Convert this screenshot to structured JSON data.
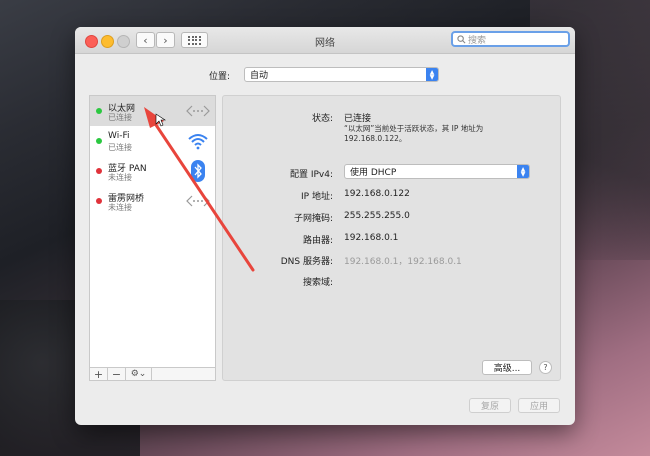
{
  "window": {
    "title": "网络"
  },
  "search": {
    "placeholder": "搜索"
  },
  "location": {
    "label": "位置:",
    "value": "自动"
  },
  "sidebar": {
    "items": [
      {
        "name": "以太网",
        "status": "已连接",
        "status_color": "#2bc840",
        "icon": "ethernet-icon"
      },
      {
        "name": "Wi-Fi",
        "status": "已连接",
        "status_color": "#2bc840",
        "icon": "wifi-icon"
      },
      {
        "name": "蓝牙 PAN",
        "status": "未连接",
        "status_color": "#e0323a",
        "icon": "bluetooth-icon"
      },
      {
        "name": "雷雳网桥",
        "status": "未连接",
        "status_color": "#e0323a",
        "icon": "thunderbolt-bridge-icon"
      }
    ],
    "add_label": "+",
    "remove_label": "−",
    "gear_label": "⚙︎⌄"
  },
  "detail": {
    "status_label": "状态:",
    "status_value": "已连接",
    "status_note": "“以太网”当前处于活跃状态，其 IP 地址为 192.168.0.122。",
    "config_label": "配置 IPv4:",
    "config_value": "使用 DHCP",
    "ip_label": "IP 地址:",
    "ip_value": "192.168.0.122",
    "subnet_label": "子网掩码:",
    "subnet_value": "255.255.255.0",
    "router_label": "路由器:",
    "router_value": "192.168.0.1",
    "dns_label": "DNS 服务器:",
    "dns_value": "192.168.0.1，192.168.0.1",
    "search_domain_label": "搜索域:",
    "advanced_label": "高级...",
    "help_label": "?"
  },
  "footer": {
    "revert_label": "复原",
    "apply_label": "应用"
  },
  "colors": {
    "accent": "#3b83f0",
    "annotation_arrow": "#e8453c"
  }
}
